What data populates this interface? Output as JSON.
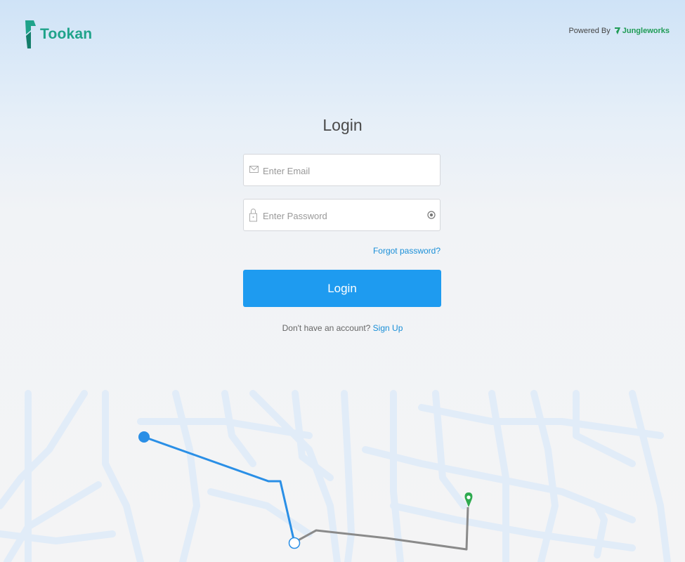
{
  "brand": {
    "name": "Tookan",
    "color": "#1fa38a"
  },
  "header": {
    "powered_by_label": "Powered By",
    "partner_name": "Jungleworks"
  },
  "login_form": {
    "title": "Login",
    "email_placeholder": "Enter Email",
    "password_placeholder": "Enter Password",
    "forgot_label": "Forgot password?",
    "submit_label": "Login",
    "no_account_text": "Don't have an account?",
    "signup_label": "Sign Up"
  },
  "icons": {
    "email": "envelope-icon",
    "password": "lock-icon",
    "reveal": "eye-icon",
    "route_start": "route-start-dot",
    "route_stop": "route-waypoint-circle",
    "destination": "map-pin-icon"
  },
  "colors": {
    "accent": "#1e9bf0",
    "link": "#1a8fd8",
    "route_active": "#2a8fe6",
    "route_pending": "#8a8a8a",
    "pin": "#2eaa4f"
  }
}
